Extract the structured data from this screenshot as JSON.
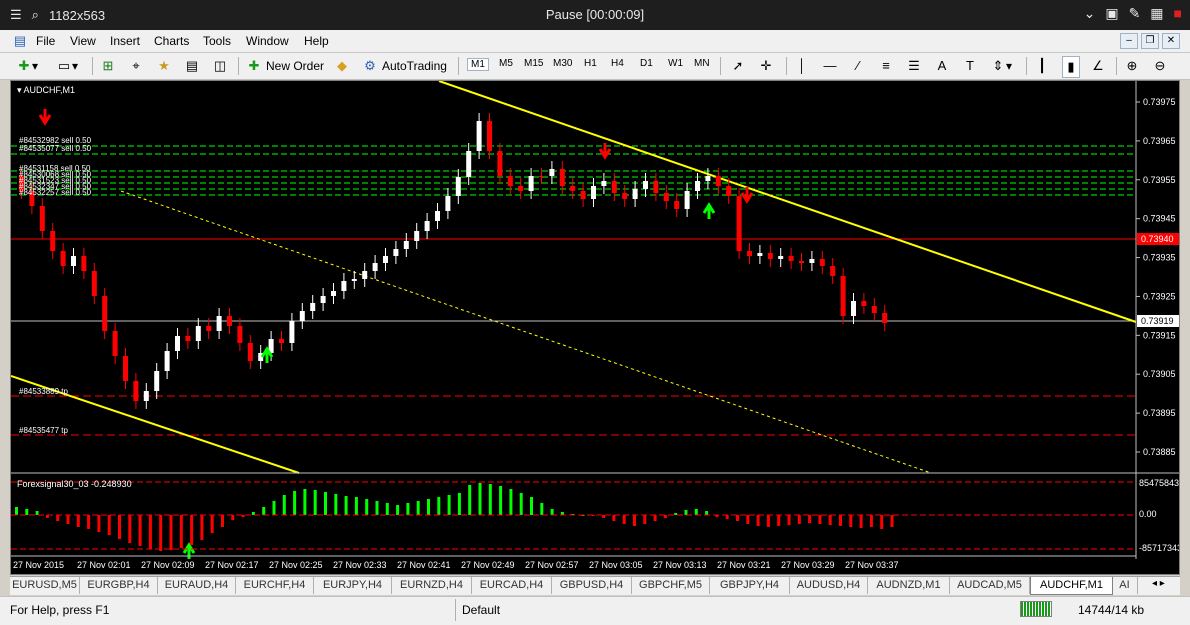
{
  "window": {
    "title_left": "1182x563",
    "title_center": "Pause [00:00:09]"
  },
  "menu": [
    "File",
    "View",
    "Insert",
    "Charts",
    "Tools",
    "Window",
    "Help"
  ],
  "toolbar": {
    "new_order": "New Order",
    "autotrading": "AutoTrading",
    "timeframes": [
      "M1",
      "M5",
      "M15",
      "M30",
      "H1",
      "H4",
      "D1",
      "W1",
      "MN"
    ],
    "active_timeframe": "M1"
  },
  "chart": {
    "symbol_label": "AUDCHF,M1",
    "bid_price": "0.73940",
    "last_price": "0.73919",
    "price_ticks": [
      "0.73975",
      "0.73965",
      "0.73955",
      "0.73945",
      "0.73935",
      "0.73925",
      "0.73915",
      "0.73905",
      "0.73895",
      "0.73885"
    ],
    "time_labels": [
      "27 Nov 2015",
      "27 Nov 02:01",
      "27 Nov 02:09",
      "27 Nov 02:17",
      "27 Nov 02:25",
      "27 Nov 02:33",
      "27 Nov 02:41",
      "27 Nov 02:49",
      "27 Nov 02:57",
      "27 Nov 03:05",
      "27 Nov 03:13",
      "27 Nov 03:21",
      "27 Nov 03:29",
      "27 Nov 03:37"
    ],
    "order_labels": [
      "#84532982 sell 0.50",
      "#84535077 sell 0.50",
      "#84531158 sell 0.50",
      "#84530068 sell 0.50",
      "#84531523 sell 0.50",
      "#84532347 sell 0.50",
      "#84532257 sell 0.50"
    ],
    "tp_labels": [
      "#84533889 tp",
      "#84535477 tp"
    ],
    "indicator_label": "Forexsignal30_03 -0.248930",
    "indicator_ticks": [
      "85475843",
      "0.00",
      "-85717343"
    ],
    "colors": {
      "bull": "#ffffff",
      "bear": "#ff0000",
      "trend": "#ffff00",
      "hist_pos": "#00ff00",
      "hist_neg": "#ff0000"
    }
  },
  "tabs": [
    "EURUSD,M5",
    "EURGBP,H4",
    "EURAUD,H4",
    "EURCHF,H4",
    "EURJPY,H4",
    "EURNZD,H4",
    "EURCAD,H4",
    "GBPUSD,H4",
    "GBPCHF,M5",
    "GBPJPY,H4",
    "AUDUSD,H4",
    "AUDNZD,M1",
    "AUDCAD,M5",
    "AUDCHF,M1",
    "AI"
  ],
  "active_tab": "AUDCHF,M1",
  "status": {
    "help": "For Help, press F1",
    "profile": "Default",
    "traffic": "14744/14 kb"
  }
}
